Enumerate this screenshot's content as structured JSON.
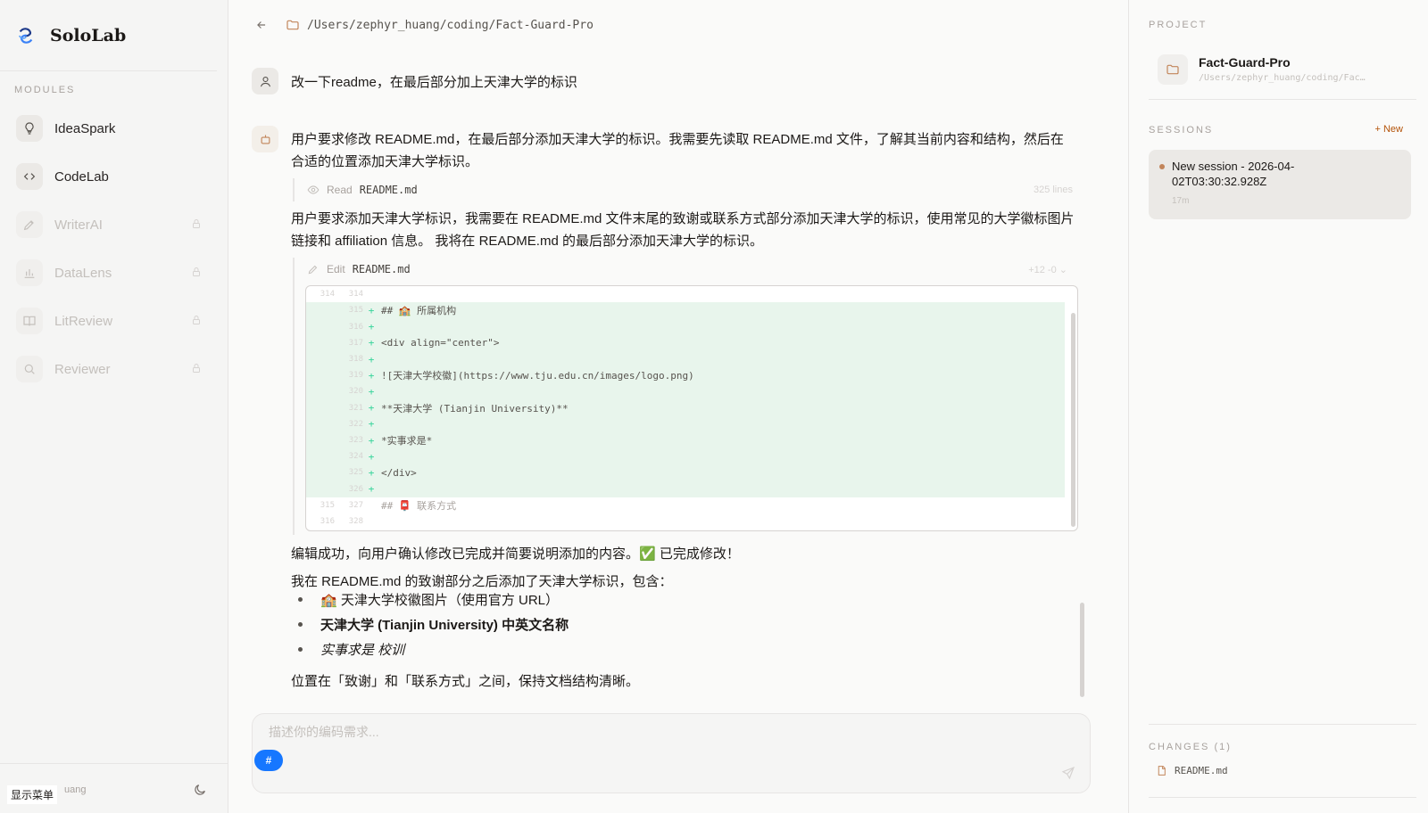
{
  "sidebar": {
    "brand": "SoloLab",
    "modules_label": "MODULES",
    "modules": [
      {
        "label": "IdeaSpark",
        "icon": "lightbulb-icon",
        "locked": false
      },
      {
        "label": "CodeLab",
        "icon": "code-icon",
        "locked": false
      },
      {
        "label": "WriterAI",
        "icon": "pen-icon",
        "locked": true
      },
      {
        "label": "DataLens",
        "icon": "bar-chart-icon",
        "locked": true
      },
      {
        "label": "LitReview",
        "icon": "book-icon",
        "locked": true
      },
      {
        "label": "Reviewer",
        "icon": "search-icon",
        "locked": true
      }
    ],
    "footer_user": "uang",
    "show_menu": "显示菜单"
  },
  "main": {
    "path": "/Users/zephyr_huang/coding/Fact-Guard-Pro",
    "user_message": "改一下readme，在最后部分加上天津大学的标识",
    "assistant": {
      "para1": "用户要求修改 README.md，在最后部分添加天津大学的标识。我需要先读取 README.md 文件，了解其当前内容和结构，然后在合适的位置添加天津大学标识。",
      "read_tool": {
        "action": "Read",
        "file": "README.md",
        "meta": "325 lines"
      },
      "para2": "用户要求添加天津大学标识，我需要在 README.md 文件末尾的致谢或联系方式部分添加天津大学的标识，使用常见的大学徽标图片链接和 affiliation 信息。 我将在 README.md 的最后部分添加天津大学的标识。",
      "edit_tool": {
        "action": "Edit",
        "file": "README.md",
        "meta": "+12 -0"
      },
      "diff": [
        {
          "old": "314",
          "new": "314",
          "sign": "",
          "code": "",
          "type": "ctx"
        },
        {
          "old": "",
          "new": "315",
          "sign": "+",
          "code": "## 🏫 所属机构",
          "type": "add"
        },
        {
          "old": "",
          "new": "316",
          "sign": "+",
          "code": "",
          "type": "add"
        },
        {
          "old": "",
          "new": "317",
          "sign": "+",
          "code": "<div align=\"center\">",
          "type": "add"
        },
        {
          "old": "",
          "new": "318",
          "sign": "+",
          "code": "",
          "type": "add"
        },
        {
          "old": "",
          "new": "319",
          "sign": "+",
          "code": "![天津大学校徽](https://www.tju.edu.cn/images/logo.png)",
          "type": "add"
        },
        {
          "old": "",
          "new": "320",
          "sign": "+",
          "code": "",
          "type": "add"
        },
        {
          "old": "",
          "new": "321",
          "sign": "+",
          "code": "**天津大学 (Tianjin University)**",
          "type": "add"
        },
        {
          "old": "",
          "new": "322",
          "sign": "+",
          "code": "",
          "type": "add"
        },
        {
          "old": "",
          "new": "323",
          "sign": "+",
          "code": "*实事求是*",
          "type": "add"
        },
        {
          "old": "",
          "new": "324",
          "sign": "+",
          "code": "",
          "type": "add"
        },
        {
          "old": "",
          "new": "325",
          "sign": "+",
          "code": "</div>",
          "type": "add"
        },
        {
          "old": "",
          "new": "326",
          "sign": "+",
          "code": "",
          "type": "add"
        },
        {
          "old": "315",
          "new": "327",
          "sign": "",
          "code": "## 📮 联系方式",
          "type": "ctx"
        },
        {
          "old": "316",
          "new": "328",
          "sign": "",
          "code": "",
          "type": "ctx"
        }
      ],
      "para3": "编辑成功，向用户确认修改已完成并简要说明添加的内容。✅ 已完成修改！",
      "para4": "我在 README.md 的致谢部分之后添加了天津大学标识，包含：",
      "bullets": [
        "🏫 天津大学校徽图片（使用官方 URL）",
        "天津大学 (Tianjin University) 中英文名称",
        "实事求是 校训"
      ],
      "para5": "位置在「致谢」和「联系方式」之间，保持文档结构清晰。"
    },
    "composer_placeholder": "描述你的编码需求...",
    "hash_label": "#"
  },
  "right": {
    "project_label": "PROJECT",
    "project_name": "Fact-Guard-Pro",
    "project_path": "/Users/zephyr_huang/coding/Fac…",
    "sessions_label": "SESSIONS",
    "new_label": "+ New",
    "session_title": "New session - 2026-04-02T03:30:32.928Z",
    "session_age": "17m",
    "changes_label": "CHANGES (1)",
    "changed_file": "README.md"
  },
  "colors": {
    "accent": "#1677ff",
    "add_bg": "#e8f5ec",
    "session_dot": "#c2855a",
    "new_link": "#b45309"
  }
}
